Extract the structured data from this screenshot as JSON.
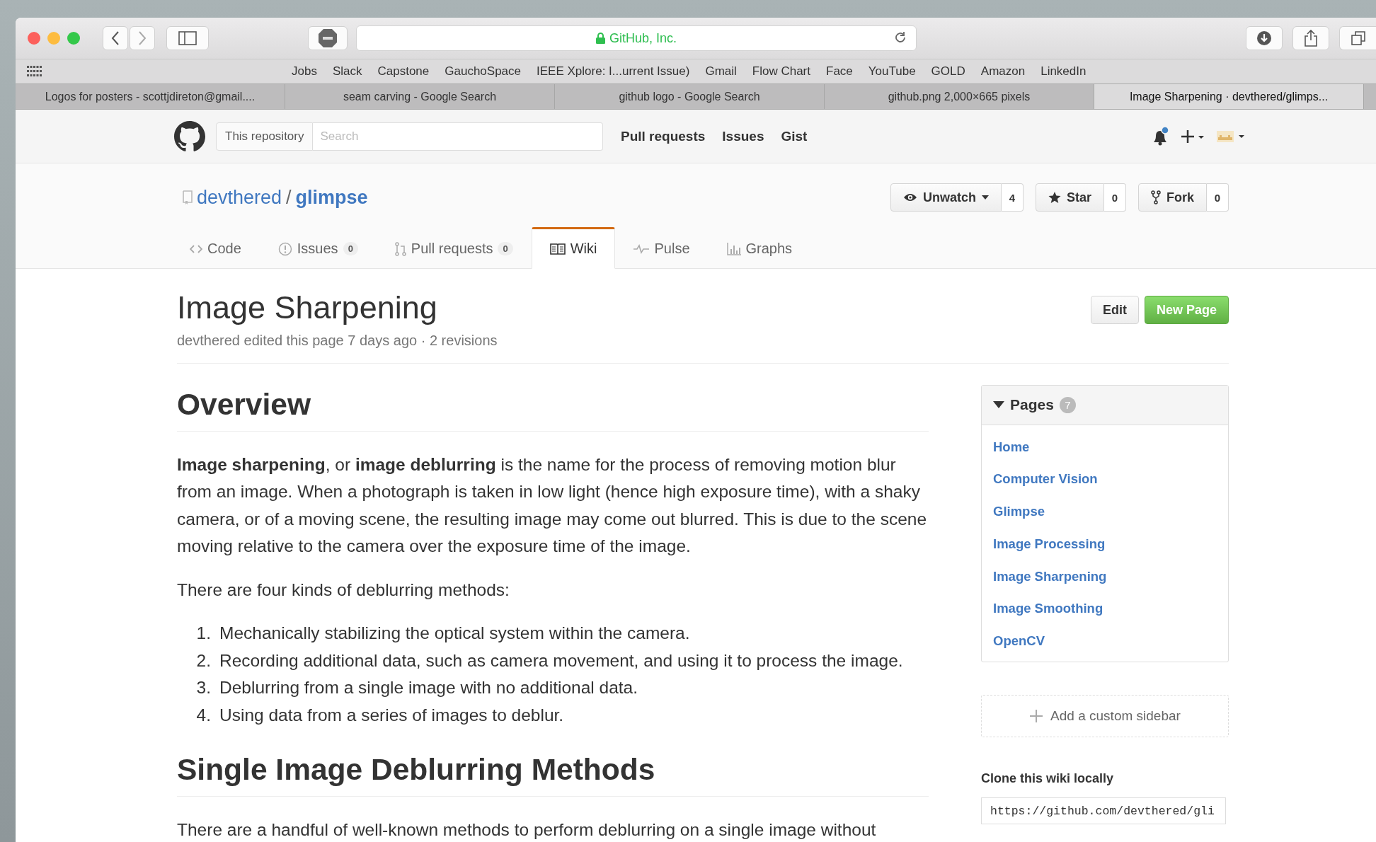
{
  "browser": {
    "address": "GitHub, Inc.",
    "secure": true,
    "bookmarks": [
      "Jobs",
      "Slack",
      "Capstone",
      "GauchoSpace",
      "IEEE Xplore: I...urrent Issue)",
      "Gmail",
      "Flow Chart",
      "Face",
      "YouTube",
      "GOLD",
      "Amazon",
      "LinkedIn"
    ],
    "tabs": [
      {
        "title": "Logos for posters - scottjdireton@gmail....",
        "selected": false
      },
      {
        "title": "seam carving - Google Search",
        "selected": false
      },
      {
        "title": "github logo - Google Search",
        "selected": false
      },
      {
        "title": "github.png 2,000×665 pixels",
        "selected": false
      },
      {
        "title": "Image Sharpening · devthered/glimps...",
        "selected": true
      }
    ]
  },
  "header": {
    "scope": "This repository",
    "search_placeholder": "Search",
    "nav": [
      "Pull requests",
      "Issues",
      "Gist"
    ],
    "unread_notifications": true
  },
  "repo": {
    "owner": "devthered",
    "separator": "/",
    "name": "glimpse",
    "actions": [
      {
        "label": "Unwatch",
        "count": "4",
        "dropdown": true
      },
      {
        "label": "Star",
        "count": "0",
        "dropdown": false
      },
      {
        "label": "Fork",
        "count": "0",
        "dropdown": false
      }
    ],
    "tabs": [
      {
        "label": "Code",
        "selected": false
      },
      {
        "label": "Issues",
        "count": "0",
        "selected": false
      },
      {
        "label": "Pull requests",
        "count": "0",
        "selected": false
      },
      {
        "label": "Wiki",
        "selected": true
      },
      {
        "label": "Pulse",
        "selected": false
      },
      {
        "label": "Graphs",
        "selected": false
      }
    ]
  },
  "page": {
    "title": "Image Sharpening",
    "meta": "devthered edited this page 7 days ago · 2 revisions",
    "edit_button": "Edit",
    "new_page_button": "New Page"
  },
  "content": [
    {
      "kind": "heading",
      "text": "Overview"
    },
    {
      "kind": "paragraph",
      "text": "**Image sharpening**, or **image deblurring** is the name for the process of removing motion blur from an image. When a photograph is taken in low light (hence high exposure time), with a shaky camera, or of a moving scene, the resulting image may come out blurred. This is due to the scene moving relative to the camera over the exposure time of the image."
    },
    {
      "kind": "paragraph",
      "text": "There are four kinds of deblurring methods:"
    },
    {
      "kind": "list",
      "items": [
        {
          "number": "1.",
          "text": "Mechanically stabilizing the optical system within the camera."
        },
        {
          "number": "2.",
          "text": "Recording additional data, such as camera movement, and using it to process the image."
        },
        {
          "number": "3.",
          "text": "Deblurring from a single image with no additional data."
        },
        {
          "number": "4.",
          "text": "Using data from a series of images to deblur."
        }
      ]
    },
    {
      "kind": "heading",
      "text": "Single Image Deblurring Methods"
    },
    {
      "kind": "paragraph",
      "text": "There are a handful of well-known methods to perform deblurring on a single image without"
    }
  ],
  "sidebar": {
    "pages_title": "Pages",
    "pages_count": "7",
    "expanded": true,
    "pages": [
      "Home",
      "Computer Vision",
      "Glimpse",
      "Image Processing",
      "Image Sharpening",
      "Image Smoothing",
      "OpenCV"
    ],
    "add_sidebar": "Add a custom sidebar",
    "clone_label": "Clone this wiki locally",
    "clone_url": "https://github.com/devthered/gli"
  }
}
